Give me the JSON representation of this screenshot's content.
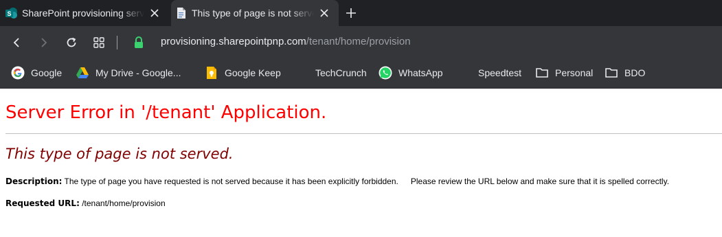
{
  "browser": {
    "tabs": [
      {
        "title": "SharePoint provisioning service",
        "icon": "sharepoint-icon",
        "active": false
      },
      {
        "title": "This type of page is not served.",
        "icon": "document-icon",
        "active": true
      }
    ],
    "address": {
      "host": "provisioning.sharepointpnp.com",
      "path": "/tenant/home/provision"
    },
    "bookmarks": [
      {
        "label": "Google",
        "icon": "google-icon"
      },
      {
        "label": "My Drive - Google...",
        "icon": "google-drive-icon"
      },
      {
        "label": "Google Keep",
        "icon": "google-keep-icon"
      },
      {
        "label": "TechCrunch",
        "icon": ""
      },
      {
        "label": "WhatsApp",
        "icon": "whatsapp-icon"
      },
      {
        "label": "Speedtest",
        "icon": ""
      },
      {
        "label": "Personal",
        "icon": "folder-icon"
      },
      {
        "label": "BDO",
        "icon": "folder-icon"
      }
    ]
  },
  "page": {
    "title": "Server Error in '/tenant' Application.",
    "subtitle": "This type of page is not served.",
    "description_label": "Description:",
    "description_text": "The type of page you have requested is not served because it has been explicitly forbidden.",
    "description_text_2": "Please review the URL below and make sure that it is spelled correctly.",
    "requested_url_label": "Requested URL:",
    "requested_url": "/tenant/home/provision"
  },
  "colors": {
    "error_title": "#ff0000",
    "error_subtitle": "#800000",
    "chrome_dark": "#202124",
    "chrome_toolbar": "#35363a"
  }
}
